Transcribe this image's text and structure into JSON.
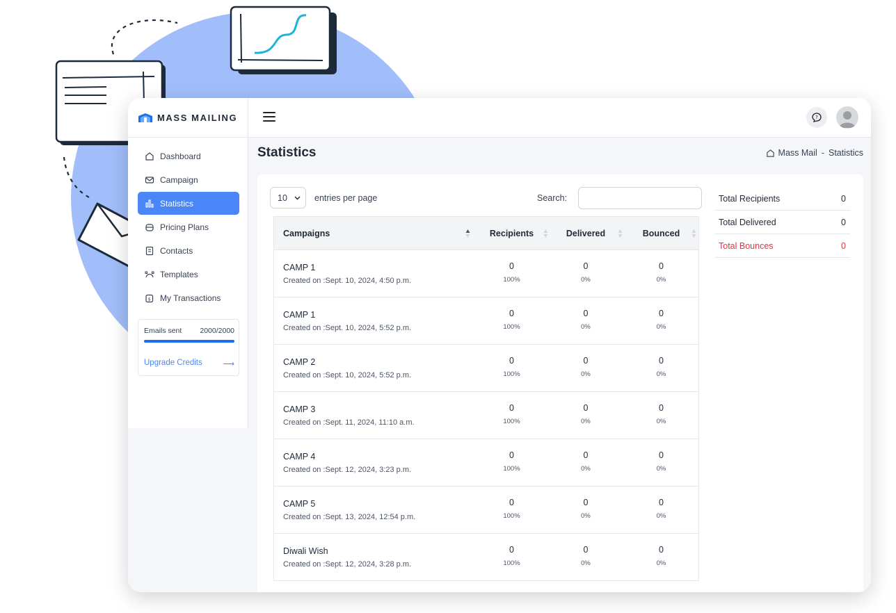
{
  "brand": {
    "name": "MASS MAILING"
  },
  "sidebar": {
    "items": [
      {
        "label": "Dashboard",
        "icon": "home-icon"
      },
      {
        "label": "Campaign",
        "icon": "envelope-icon"
      },
      {
        "label": "Statistics",
        "icon": "bar-chart-icon",
        "active": true
      },
      {
        "label": "Pricing Plans",
        "icon": "tag-icon"
      },
      {
        "label": "Contacts",
        "icon": "contacts-icon"
      },
      {
        "label": "Templates",
        "icon": "pen-tool-icon"
      },
      {
        "label": "My Transactions",
        "icon": "transactions-icon"
      }
    ],
    "credits": {
      "label": "Emails sent",
      "value": "2000/2000",
      "progress": 1.0,
      "upgrade_label": "Upgrade Credits",
      "arrow": "⟶"
    }
  },
  "header": {
    "title": "Statistics",
    "breadcrumb": {
      "home": "Mass Mail",
      "sep": "-",
      "current": "Statistics"
    }
  },
  "table_controls": {
    "page_size": "10",
    "entries_label": "entries per page",
    "search_label": "Search:",
    "search_value": ""
  },
  "table": {
    "columns": [
      "Campaigns",
      "Recipients",
      "Delivered",
      "Bounced"
    ],
    "rows": [
      {
        "name": "CAMP 1",
        "created": "Created on :Sept. 10, 2024, 4:50 p.m.",
        "recipients": "0",
        "recipients_pct": "100%",
        "delivered": "0",
        "delivered_pct": "0%",
        "bounced": "0",
        "bounced_pct": "0%"
      },
      {
        "name": "CAMP 1",
        "created": "Created on :Sept. 10, 2024, 5:52 p.m.",
        "recipients": "0",
        "recipients_pct": "100%",
        "delivered": "0",
        "delivered_pct": "0%",
        "bounced": "0",
        "bounced_pct": "0%"
      },
      {
        "name": "CAMP 2",
        "created": "Created on :Sept. 10, 2024, 5:52 p.m.",
        "recipients": "0",
        "recipients_pct": "100%",
        "delivered": "0",
        "delivered_pct": "0%",
        "bounced": "0",
        "bounced_pct": "0%"
      },
      {
        "name": "CAMP 3",
        "created": "Created on :Sept. 11, 2024, 11:10 a.m.",
        "recipients": "0",
        "recipients_pct": "100%",
        "delivered": "0",
        "delivered_pct": "0%",
        "bounced": "0",
        "bounced_pct": "0%"
      },
      {
        "name": "CAMP 4",
        "created": "Created on :Sept. 12, 2024, 3:23 p.m.",
        "recipients": "0",
        "recipients_pct": "100%",
        "delivered": "0",
        "delivered_pct": "0%",
        "bounced": "0",
        "bounced_pct": "0%"
      },
      {
        "name": "CAMP 5",
        "created": "Created on :Sept. 13, 2024, 12:54 p.m.",
        "recipients": "0",
        "recipients_pct": "100%",
        "delivered": "0",
        "delivered_pct": "0%",
        "bounced": "0",
        "bounced_pct": "0%"
      },
      {
        "name": "Diwali Wish",
        "created": "Created on :Sept. 12, 2024, 3:28 p.m.",
        "recipients": "0",
        "recipients_pct": "100%",
        "delivered": "0",
        "delivered_pct": "0%",
        "bounced": "0",
        "bounced_pct": "0%"
      }
    ]
  },
  "totals": [
    {
      "label": "Total Recipients",
      "value": "0",
      "color": "#1f2937"
    },
    {
      "label": "Total Delivered",
      "value": "0",
      "color": "#1f2937"
    },
    {
      "label": "Total Bounces",
      "value": "0",
      "color": "#dc3545"
    }
  ],
  "colors": {
    "accent": "#4a86f7",
    "progress": "#1a6ef0",
    "danger": "#dc3545",
    "deco_circle": "#a1befa",
    "deco_chart_line": "#1eb3d6"
  }
}
